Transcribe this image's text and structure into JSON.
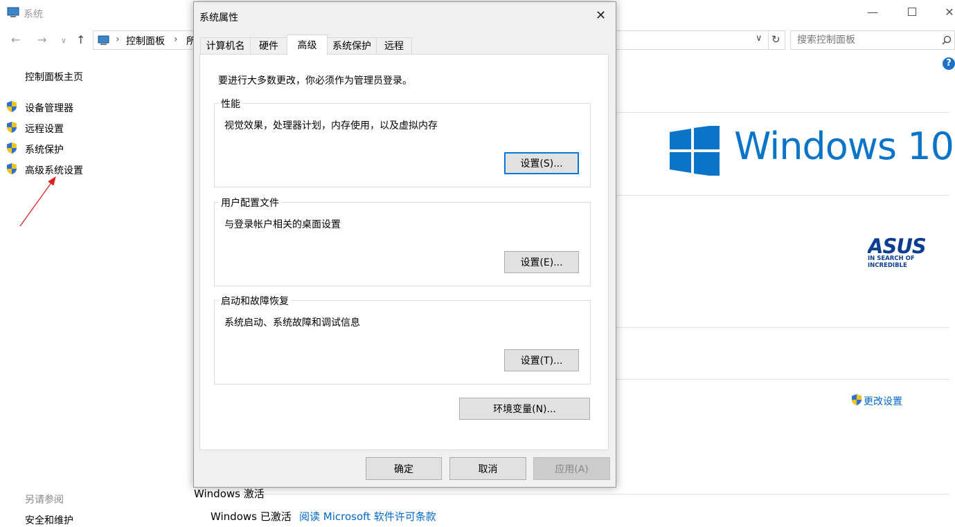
{
  "window": {
    "title": "系统",
    "breadcrumb": [
      "控制面板",
      "所"
    ],
    "search_placeholder": "搜索控制面板"
  },
  "sidebar": {
    "home": "控制面板主页",
    "items": [
      {
        "label": "设备管理器"
      },
      {
        "label": "远程设置"
      },
      {
        "label": "系统保护"
      },
      {
        "label": "高级系统设置"
      }
    ],
    "see_also_header": "另请参阅",
    "see_also": [
      "安全和维护"
    ]
  },
  "main": {
    "windows_logo_text": "Windows 10",
    "oem_logo_tagline": "IN SEARCH OF INCREDIBLE",
    "change_settings": "更改设置",
    "activation_header": "Windows 激活",
    "activation_status": "Windows 已激活",
    "license_link": "阅读 Microsoft 软件许可条款"
  },
  "dialog": {
    "title": "系统属性",
    "tabs": [
      {
        "label": "计算机名"
      },
      {
        "label": "硬件"
      },
      {
        "label": "高级",
        "active": true
      },
      {
        "label": "系统保护"
      },
      {
        "label": "远程"
      }
    ],
    "admin_note": "要进行大多数更改，你必须作为管理员登录。",
    "performance": {
      "title": "性能",
      "description": "视觉效果，处理器计划，内存使用，以及虚拟内存",
      "button": "设置(S)..."
    },
    "user_profiles": {
      "title": "用户配置文件",
      "description": "与登录帐户相关的桌面设置",
      "button": "设置(E)..."
    },
    "startup_recovery": {
      "title": "启动和故障恢复",
      "description": "系统启动、系统故障和调试信息",
      "button": "设置(T)..."
    },
    "env_button": "环境变量(N)...",
    "ok": "确定",
    "cancel": "取消",
    "apply": "应用(A)"
  },
  "colors": {
    "accent": "#0078d7",
    "link": "#0066cc",
    "annotation_arrow": "#e02020"
  }
}
